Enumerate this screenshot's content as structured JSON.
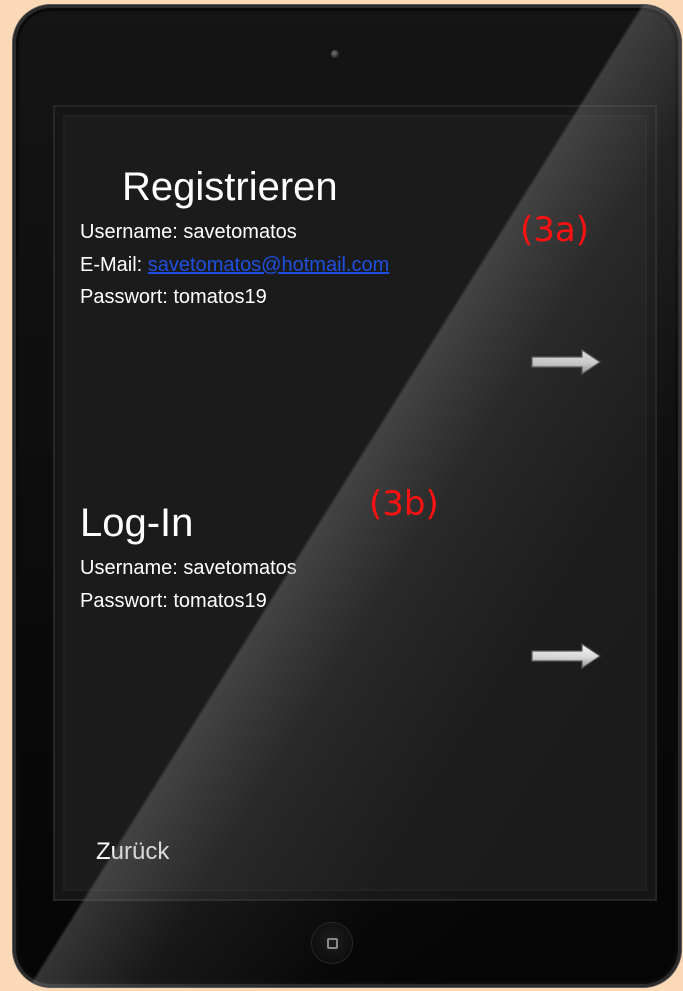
{
  "register": {
    "title": "Registrieren",
    "username_line": "Username: savetomatos",
    "email_label": "E-Mail: ",
    "email_value": "savetomatos@hotmail.com",
    "password_line": "Passwort: tomatos19",
    "annotation": "(3a)",
    "next_icon": "right-arrow-icon"
  },
  "login": {
    "title": "Log-In",
    "username_line": "Username: savetomatos",
    "password_line": "Passwort: tomatos19",
    "annotation": "(3b)",
    "next_icon": "right-arrow-icon"
  },
  "footer": {
    "back_label": "Zurück"
  },
  "colors": {
    "page_background": "#fcd9b6",
    "annotation": "#ff1010",
    "link": "#1e4fe0"
  }
}
